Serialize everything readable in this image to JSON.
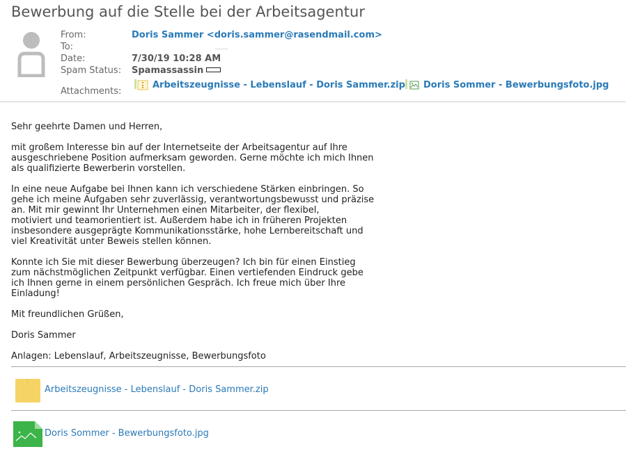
{
  "message": {
    "subject": "Bewerbung auf die Stelle bei der Arbeitsagentur"
  },
  "header": {
    "from_label": "From:",
    "from_value": "Doris Sammer <doris.sammer@rasendmail.com>",
    "to_label": "To:",
    "to_value": "",
    "date_label": "Date:",
    "date_value": "7/30/19 10:28 AM",
    "spam_label": "Spam Status:",
    "spam_value": "Spamassassin",
    "attachments_label": "Attachments:",
    "attachments": [
      {
        "name": "Arbeitszeugnisse - Lebenslauf - Doris Sammer.zip",
        "icon": "zip-file-icon"
      },
      {
        "name": "Doris Sommer - Bewerbungsfoto.jpg",
        "icon": "image-file-icon"
      }
    ]
  },
  "body": {
    "paragraphs": [
      "Sehr geehrte Damen und Herren,",
      "mit großem Interesse bin auf der Internetseite der Arbeitsagentur auf Ihre\nausgeschriebene Position aufmerksam geworden. Gerne möchte ich mich Ihnen\nals qualifizierte Bewerberin vorstellen.",
      "In eine neue Aufgabe bei Ihnen kann ich verschiedene Stärken einbringen. So\ngehe ich meine Aufgaben sehr zuverlässig, verantwortungsbewusst und präzise\nan. Mit mir gewinnt Ihr Unternehmen einen Mitarbeiter, der flexibel,\nmotiviert und teamorientiert ist. Außerdem habe ich in früheren Projekten\ninsbesondere ausgeprägte Kommunikationsstärke, hohe Lernbereitschaft und\nviel Kreativität unter Beweis stellen können.",
      "Konnte ich Sie mit dieser Bewerbung überzeugen? Ich bin für einen Einstieg\nzum nächstmöglichen Zeitpunkt verfügbar. Einen vertiefenden Eindruck gebe\nich Ihnen gerne in einem persönlichen Gespräch. Ich freue mich über Ihre\nEinladung!",
      "Mit freundlichen Grüßen,",
      "Doris Sammer",
      "Anlagen: Lebenslauf, Arbeitszeugnisse, Bewerbungsfoto"
    ]
  },
  "attachment_list": [
    {
      "name": "Arbeitszeugnisse - Lebenslauf - Doris Sammer.zip",
      "icon": "folder-zip-icon"
    },
    {
      "name": "Doris Sommer - Bewerbungsfoto.jpg",
      "icon": "image-thumbnail-icon"
    }
  ],
  "colors": {
    "link": "#2a7ab8",
    "zip_yellow": "#f6d365",
    "image_green": "#3cb449"
  }
}
